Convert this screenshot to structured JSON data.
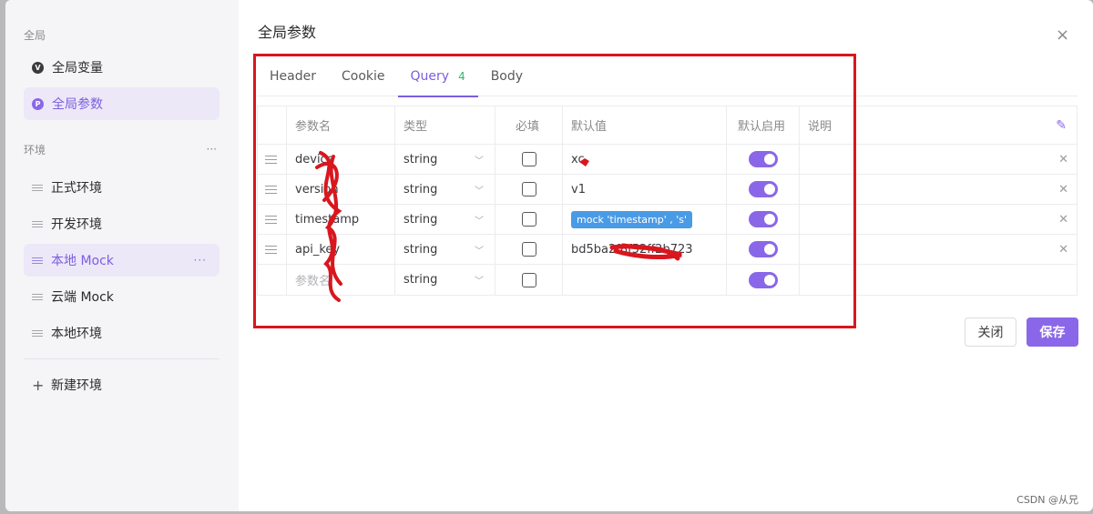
{
  "sidebar": {
    "section_global": "全局",
    "items_global": [
      {
        "label": "全局变量",
        "icon": "v"
      },
      {
        "label": "全局参数",
        "icon": "p"
      }
    ],
    "section_env": "环境",
    "env_more": "···",
    "envs": [
      "正式环境",
      "开发环境",
      "本地 Mock",
      "云端 Mock",
      "本地环境"
    ],
    "active_env_more": "···",
    "new_env": "新建环境"
  },
  "dialog": {
    "title": "全局参数",
    "close_icon": "×",
    "tabs": [
      {
        "label": "Header"
      },
      {
        "label": "Cookie"
      },
      {
        "label": "Query",
        "badge": "4"
      },
      {
        "label": "Body"
      }
    ],
    "active_tab": "Query",
    "columns": [
      "参数名",
      "类型",
      "必填",
      "默认值",
      "默认启用",
      "说明"
    ],
    "rows": [
      {
        "name": "device",
        "type": "string",
        "default": "xc",
        "default_tag": ""
      },
      {
        "name": "version",
        "type": "string",
        "default": "v1",
        "default_tag": ""
      },
      {
        "name": "timestamp",
        "type": "string",
        "default": "",
        "default_tag": "mock 'timestamp' , 's'"
      },
      {
        "name": "api_key",
        "type": "string",
        "default": "bd5ba2f8f52ff2b723",
        "default_tag": ""
      }
    ],
    "new_row": {
      "placeholder": "参数名",
      "type": "string"
    },
    "buttons": {
      "close": "关闭",
      "save": "保存"
    }
  },
  "watermark": "CSDN @从兄",
  "colors": {
    "accent": "#8a67e8",
    "annotation": "#d9161e",
    "mock_tag": "#4a9be6"
  }
}
